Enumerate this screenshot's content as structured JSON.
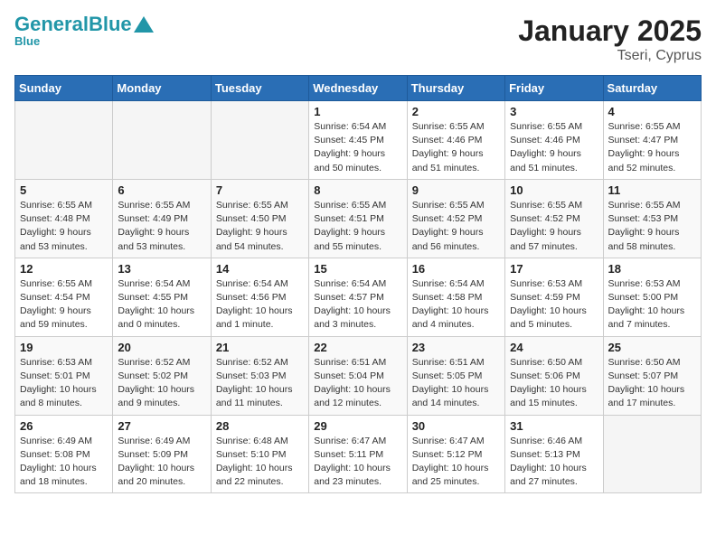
{
  "header": {
    "logo_general": "General",
    "logo_blue": "Blue",
    "title": "January 2025",
    "subtitle": "Tseri, Cyprus"
  },
  "days_of_week": [
    "Sunday",
    "Monday",
    "Tuesday",
    "Wednesday",
    "Thursday",
    "Friday",
    "Saturday"
  ],
  "weeks": [
    [
      {
        "day": "",
        "info": ""
      },
      {
        "day": "",
        "info": ""
      },
      {
        "day": "",
        "info": ""
      },
      {
        "day": "1",
        "info": "Sunrise: 6:54 AM\nSunset: 4:45 PM\nDaylight: 9 hours\nand 50 minutes."
      },
      {
        "day": "2",
        "info": "Sunrise: 6:55 AM\nSunset: 4:46 PM\nDaylight: 9 hours\nand 51 minutes."
      },
      {
        "day": "3",
        "info": "Sunrise: 6:55 AM\nSunset: 4:46 PM\nDaylight: 9 hours\nand 51 minutes."
      },
      {
        "day": "4",
        "info": "Sunrise: 6:55 AM\nSunset: 4:47 PM\nDaylight: 9 hours\nand 52 minutes."
      }
    ],
    [
      {
        "day": "5",
        "info": "Sunrise: 6:55 AM\nSunset: 4:48 PM\nDaylight: 9 hours\nand 53 minutes."
      },
      {
        "day": "6",
        "info": "Sunrise: 6:55 AM\nSunset: 4:49 PM\nDaylight: 9 hours\nand 53 minutes."
      },
      {
        "day": "7",
        "info": "Sunrise: 6:55 AM\nSunset: 4:50 PM\nDaylight: 9 hours\nand 54 minutes."
      },
      {
        "day": "8",
        "info": "Sunrise: 6:55 AM\nSunset: 4:51 PM\nDaylight: 9 hours\nand 55 minutes."
      },
      {
        "day": "9",
        "info": "Sunrise: 6:55 AM\nSunset: 4:52 PM\nDaylight: 9 hours\nand 56 minutes."
      },
      {
        "day": "10",
        "info": "Sunrise: 6:55 AM\nSunset: 4:52 PM\nDaylight: 9 hours\nand 57 minutes."
      },
      {
        "day": "11",
        "info": "Sunrise: 6:55 AM\nSunset: 4:53 PM\nDaylight: 9 hours\nand 58 minutes."
      }
    ],
    [
      {
        "day": "12",
        "info": "Sunrise: 6:55 AM\nSunset: 4:54 PM\nDaylight: 9 hours\nand 59 minutes."
      },
      {
        "day": "13",
        "info": "Sunrise: 6:54 AM\nSunset: 4:55 PM\nDaylight: 10 hours\nand 0 minutes."
      },
      {
        "day": "14",
        "info": "Sunrise: 6:54 AM\nSunset: 4:56 PM\nDaylight: 10 hours\nand 1 minute."
      },
      {
        "day": "15",
        "info": "Sunrise: 6:54 AM\nSunset: 4:57 PM\nDaylight: 10 hours\nand 3 minutes."
      },
      {
        "day": "16",
        "info": "Sunrise: 6:54 AM\nSunset: 4:58 PM\nDaylight: 10 hours\nand 4 minutes."
      },
      {
        "day": "17",
        "info": "Sunrise: 6:53 AM\nSunset: 4:59 PM\nDaylight: 10 hours\nand 5 minutes."
      },
      {
        "day": "18",
        "info": "Sunrise: 6:53 AM\nSunset: 5:00 PM\nDaylight: 10 hours\nand 7 minutes."
      }
    ],
    [
      {
        "day": "19",
        "info": "Sunrise: 6:53 AM\nSunset: 5:01 PM\nDaylight: 10 hours\nand 8 minutes."
      },
      {
        "day": "20",
        "info": "Sunrise: 6:52 AM\nSunset: 5:02 PM\nDaylight: 10 hours\nand 9 minutes."
      },
      {
        "day": "21",
        "info": "Sunrise: 6:52 AM\nSunset: 5:03 PM\nDaylight: 10 hours\nand 11 minutes."
      },
      {
        "day": "22",
        "info": "Sunrise: 6:51 AM\nSunset: 5:04 PM\nDaylight: 10 hours\nand 12 minutes."
      },
      {
        "day": "23",
        "info": "Sunrise: 6:51 AM\nSunset: 5:05 PM\nDaylight: 10 hours\nand 14 minutes."
      },
      {
        "day": "24",
        "info": "Sunrise: 6:50 AM\nSunset: 5:06 PM\nDaylight: 10 hours\nand 15 minutes."
      },
      {
        "day": "25",
        "info": "Sunrise: 6:50 AM\nSunset: 5:07 PM\nDaylight: 10 hours\nand 17 minutes."
      }
    ],
    [
      {
        "day": "26",
        "info": "Sunrise: 6:49 AM\nSunset: 5:08 PM\nDaylight: 10 hours\nand 18 minutes."
      },
      {
        "day": "27",
        "info": "Sunrise: 6:49 AM\nSunset: 5:09 PM\nDaylight: 10 hours\nand 20 minutes."
      },
      {
        "day": "28",
        "info": "Sunrise: 6:48 AM\nSunset: 5:10 PM\nDaylight: 10 hours\nand 22 minutes."
      },
      {
        "day": "29",
        "info": "Sunrise: 6:47 AM\nSunset: 5:11 PM\nDaylight: 10 hours\nand 23 minutes."
      },
      {
        "day": "30",
        "info": "Sunrise: 6:47 AM\nSunset: 5:12 PM\nDaylight: 10 hours\nand 25 minutes."
      },
      {
        "day": "31",
        "info": "Sunrise: 6:46 AM\nSunset: 5:13 PM\nDaylight: 10 hours\nand 27 minutes."
      },
      {
        "day": "",
        "info": ""
      }
    ]
  ]
}
